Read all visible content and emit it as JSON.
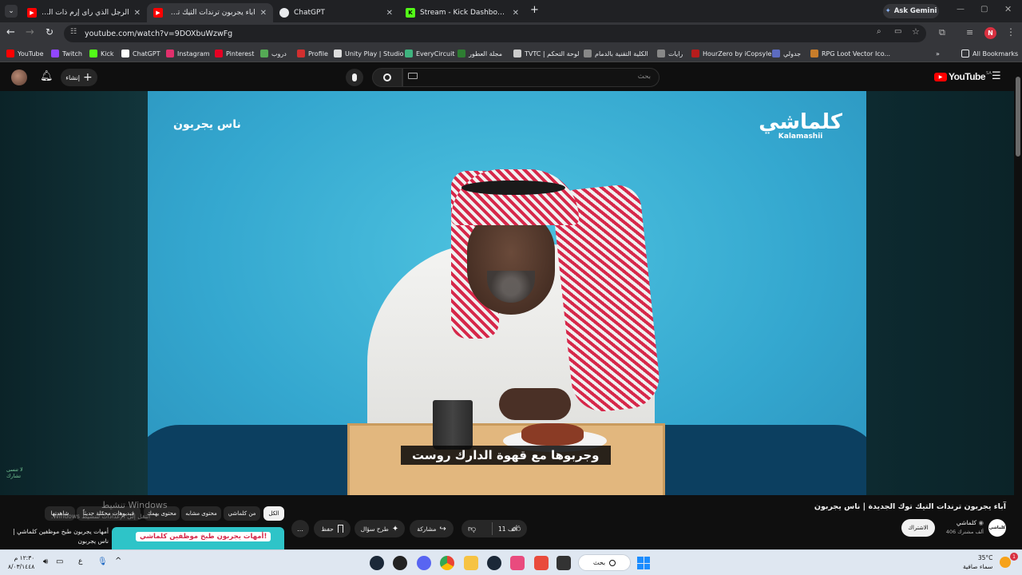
{
  "browser": {
    "tabs": [
      {
        "title": "الرجل الذي رأى إرم ذات العماد ! -",
        "icon": "youtube-icon",
        "active": false
      },
      {
        "title": "آباء يجربون ترندات التيك توك الجد",
        "icon": "youtube-icon",
        "active": true
      },
      {
        "title": "ChatGPT",
        "icon": "chatgpt-icon",
        "active": false
      },
      {
        "title": "Stream - Kick Dashboard",
        "icon": "kick-icon",
        "active": false
      }
    ],
    "new_tab": "+",
    "ask_gemini": "Ask Gemini",
    "url": "youtube.com/watch?v=9DOXbuWzwFg"
  },
  "bookmarks": {
    "items": [
      {
        "label": "YouTube",
        "color": "#ff0000"
      },
      {
        "label": "Twitch",
        "color": "#9146ff"
      },
      {
        "label": "Kick",
        "color": "#53fc18"
      },
      {
        "label": "ChatGPT",
        "color": "#ffffff"
      },
      {
        "label": "Instagram",
        "color": "#e1306c"
      },
      {
        "label": "Pinterest",
        "color": "#e60023"
      },
      {
        "label": "دروب",
        "color": "#55aa55"
      },
      {
        "label": "Profile",
        "color": "#d22f2f"
      },
      {
        "label": "Unity Play | Studio",
        "color": "#dddddd"
      },
      {
        "label": "EveryCircuit",
        "color": "#3fb37f"
      },
      {
        "label": "مجلة العطور",
        "color": "#2e7d32"
      },
      {
        "label": "TVTC | لوحة التحكم",
        "color": "#cccccc"
      },
      {
        "label": "الكلية التقنية بالدمام",
        "color": "#888888"
      },
      {
        "label": "رايات",
        "color": "#888888"
      },
      {
        "label": "HourZero by iCopsyle",
        "color": "#b71c1c"
      },
      {
        "label": "جدولي",
        "color": "#5c6bc0"
      },
      {
        "label": "RPG Loot Vector Ico...",
        "color": "#c77d2b"
      }
    ],
    "overflow": "»",
    "all_bookmarks": "All Bookmarks"
  },
  "youtube": {
    "create_label": "إنشاء",
    "search_placeholder": "بحث",
    "logo_text": "YouTube",
    "logo_region": "SA"
  },
  "video": {
    "caption_top_left": "ناس يجربون",
    "brand_logo": "كلماشي",
    "brand_latin": "Kalamashii",
    "subtitle": "وجربوها مع قهوة الدارك روست",
    "watermark": "لا تنسى\nتشارك"
  },
  "meta": {
    "title": "آباء يجربون ترندات التيك توك الجديدة | ناس يجربون",
    "channel_name": "كلماشي",
    "subscribers": "406 ألف مشترك",
    "subscribe_label": "الاشتراك",
    "likes": "11 ألف",
    "share_label": "مشاركة",
    "ask_label": "طرح سؤال",
    "save_label": "حفظ",
    "more_label": "…"
  },
  "chips": [
    {
      "label": "الكل",
      "selected": true
    },
    {
      "label": "من كلماشي",
      "selected": false
    },
    {
      "label": "محتوى مشابه",
      "selected": false
    },
    {
      "label": "محتوى يهمك",
      "selected": false
    },
    {
      "label": "فيديوهات محمّلة حديثاً",
      "selected": false
    },
    {
      "label": "شاهدتها",
      "selected": false
    }
  ],
  "recommendation": {
    "thumbnail_text": "أمهات يجربون طبخ موظفين كلماشي!",
    "title": "أمهات يجربون طبخ موظفين كلماشي | ناس يجربون"
  },
  "windows": {
    "activate_title": "تنشيط Windows",
    "activate_sub": "انتقل إلى الإعدادات لتنشيط Windows.",
    "search_label": "بحث",
    "weather_temp": "35°C",
    "weather_desc": "سماء صافية",
    "time": "١٢:٣٠ م",
    "date": "٨/٠٣/١٤٤٨",
    "lang": "ع",
    "notification_count": "1"
  }
}
